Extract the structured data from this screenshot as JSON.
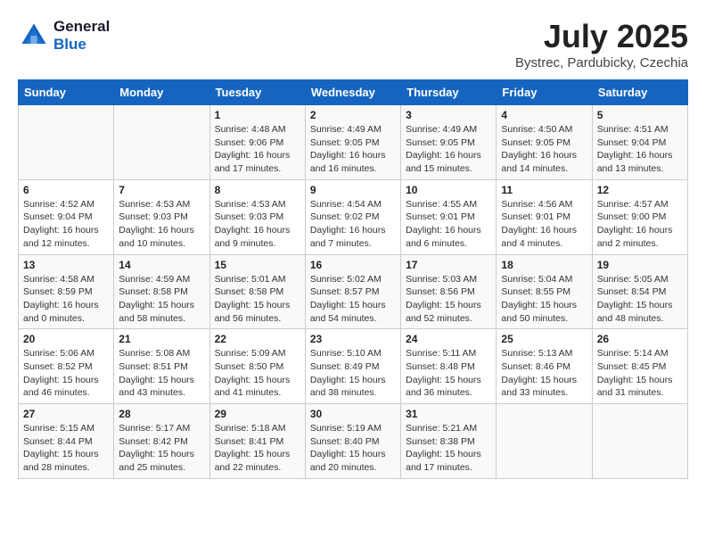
{
  "header": {
    "logo_line1": "General",
    "logo_line2": "Blue",
    "month": "July 2025",
    "location": "Bystrec, Pardubicky, Czechia"
  },
  "weekdays": [
    "Sunday",
    "Monday",
    "Tuesday",
    "Wednesday",
    "Thursday",
    "Friday",
    "Saturday"
  ],
  "weeks": [
    [
      {
        "day": "",
        "info": ""
      },
      {
        "day": "",
        "info": ""
      },
      {
        "day": "1",
        "info": "Sunrise: 4:48 AM\nSunset: 9:06 PM\nDaylight: 16 hours\nand 17 minutes."
      },
      {
        "day": "2",
        "info": "Sunrise: 4:49 AM\nSunset: 9:05 PM\nDaylight: 16 hours\nand 16 minutes."
      },
      {
        "day": "3",
        "info": "Sunrise: 4:49 AM\nSunset: 9:05 PM\nDaylight: 16 hours\nand 15 minutes."
      },
      {
        "day": "4",
        "info": "Sunrise: 4:50 AM\nSunset: 9:05 PM\nDaylight: 16 hours\nand 14 minutes."
      },
      {
        "day": "5",
        "info": "Sunrise: 4:51 AM\nSunset: 9:04 PM\nDaylight: 16 hours\nand 13 minutes."
      }
    ],
    [
      {
        "day": "6",
        "info": "Sunrise: 4:52 AM\nSunset: 9:04 PM\nDaylight: 16 hours\nand 12 minutes."
      },
      {
        "day": "7",
        "info": "Sunrise: 4:53 AM\nSunset: 9:03 PM\nDaylight: 16 hours\nand 10 minutes."
      },
      {
        "day": "8",
        "info": "Sunrise: 4:53 AM\nSunset: 9:03 PM\nDaylight: 16 hours\nand 9 minutes."
      },
      {
        "day": "9",
        "info": "Sunrise: 4:54 AM\nSunset: 9:02 PM\nDaylight: 16 hours\nand 7 minutes."
      },
      {
        "day": "10",
        "info": "Sunrise: 4:55 AM\nSunset: 9:01 PM\nDaylight: 16 hours\nand 6 minutes."
      },
      {
        "day": "11",
        "info": "Sunrise: 4:56 AM\nSunset: 9:01 PM\nDaylight: 16 hours\nand 4 minutes."
      },
      {
        "day": "12",
        "info": "Sunrise: 4:57 AM\nSunset: 9:00 PM\nDaylight: 16 hours\nand 2 minutes."
      }
    ],
    [
      {
        "day": "13",
        "info": "Sunrise: 4:58 AM\nSunset: 8:59 PM\nDaylight: 16 hours\nand 0 minutes."
      },
      {
        "day": "14",
        "info": "Sunrise: 4:59 AM\nSunset: 8:58 PM\nDaylight: 15 hours\nand 58 minutes."
      },
      {
        "day": "15",
        "info": "Sunrise: 5:01 AM\nSunset: 8:58 PM\nDaylight: 15 hours\nand 56 minutes."
      },
      {
        "day": "16",
        "info": "Sunrise: 5:02 AM\nSunset: 8:57 PM\nDaylight: 15 hours\nand 54 minutes."
      },
      {
        "day": "17",
        "info": "Sunrise: 5:03 AM\nSunset: 8:56 PM\nDaylight: 15 hours\nand 52 minutes."
      },
      {
        "day": "18",
        "info": "Sunrise: 5:04 AM\nSunset: 8:55 PM\nDaylight: 15 hours\nand 50 minutes."
      },
      {
        "day": "19",
        "info": "Sunrise: 5:05 AM\nSunset: 8:54 PM\nDaylight: 15 hours\nand 48 minutes."
      }
    ],
    [
      {
        "day": "20",
        "info": "Sunrise: 5:06 AM\nSunset: 8:52 PM\nDaylight: 15 hours\nand 46 minutes."
      },
      {
        "day": "21",
        "info": "Sunrise: 5:08 AM\nSunset: 8:51 PM\nDaylight: 15 hours\nand 43 minutes."
      },
      {
        "day": "22",
        "info": "Sunrise: 5:09 AM\nSunset: 8:50 PM\nDaylight: 15 hours\nand 41 minutes."
      },
      {
        "day": "23",
        "info": "Sunrise: 5:10 AM\nSunset: 8:49 PM\nDaylight: 15 hours\nand 38 minutes."
      },
      {
        "day": "24",
        "info": "Sunrise: 5:11 AM\nSunset: 8:48 PM\nDaylight: 15 hours\nand 36 minutes."
      },
      {
        "day": "25",
        "info": "Sunrise: 5:13 AM\nSunset: 8:46 PM\nDaylight: 15 hours\nand 33 minutes."
      },
      {
        "day": "26",
        "info": "Sunrise: 5:14 AM\nSunset: 8:45 PM\nDaylight: 15 hours\nand 31 minutes."
      }
    ],
    [
      {
        "day": "27",
        "info": "Sunrise: 5:15 AM\nSunset: 8:44 PM\nDaylight: 15 hours\nand 28 minutes."
      },
      {
        "day": "28",
        "info": "Sunrise: 5:17 AM\nSunset: 8:42 PM\nDaylight: 15 hours\nand 25 minutes."
      },
      {
        "day": "29",
        "info": "Sunrise: 5:18 AM\nSunset: 8:41 PM\nDaylight: 15 hours\nand 22 minutes."
      },
      {
        "day": "30",
        "info": "Sunrise: 5:19 AM\nSunset: 8:40 PM\nDaylight: 15 hours\nand 20 minutes."
      },
      {
        "day": "31",
        "info": "Sunrise: 5:21 AM\nSunset: 8:38 PM\nDaylight: 15 hours\nand 17 minutes."
      },
      {
        "day": "",
        "info": ""
      },
      {
        "day": "",
        "info": ""
      }
    ]
  ]
}
